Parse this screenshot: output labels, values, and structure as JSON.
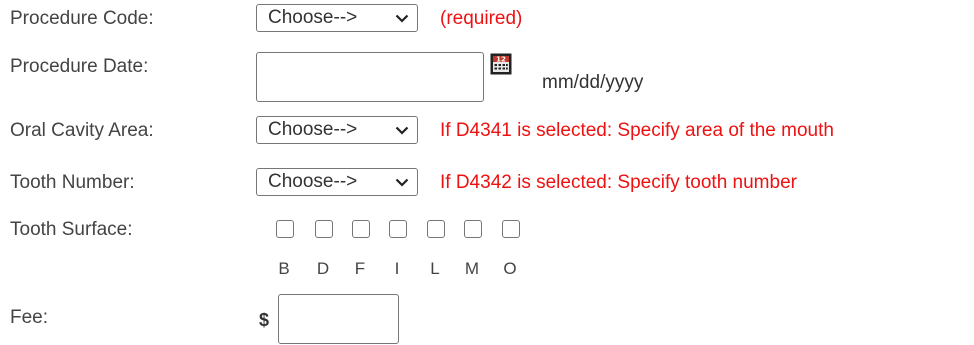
{
  "form": {
    "procedure_code": {
      "label": "Procedure Code:",
      "value": "Choose-->",
      "note": "(required)"
    },
    "procedure_date": {
      "label": "Procedure Date:",
      "value": "",
      "format_hint": "mm/dd/yyyy",
      "calendar_icon": "calendar-icon"
    },
    "oral_cavity_area": {
      "label": "Oral Cavity Area:",
      "value": "Choose-->",
      "note": "If D4341 is selected: Specify area of the mouth"
    },
    "tooth_number": {
      "label": "Tooth Number:",
      "value": "Choose-->",
      "note": "If D4342 is selected: Specify tooth number"
    },
    "tooth_surface": {
      "label": "Tooth Surface:",
      "options": [
        {
          "code": "B",
          "checked": false
        },
        {
          "code": "D",
          "checked": false
        },
        {
          "code": "F",
          "checked": false
        },
        {
          "code": "I",
          "checked": false
        },
        {
          "code": "L",
          "checked": false
        },
        {
          "code": "M",
          "checked": false
        },
        {
          "code": "O",
          "checked": false
        }
      ]
    },
    "fee": {
      "label": "Fee:",
      "currency_symbol": "$",
      "value": ""
    }
  },
  "colors": {
    "required_note": "#ee1111",
    "label": "#444444",
    "border": "#767676"
  }
}
